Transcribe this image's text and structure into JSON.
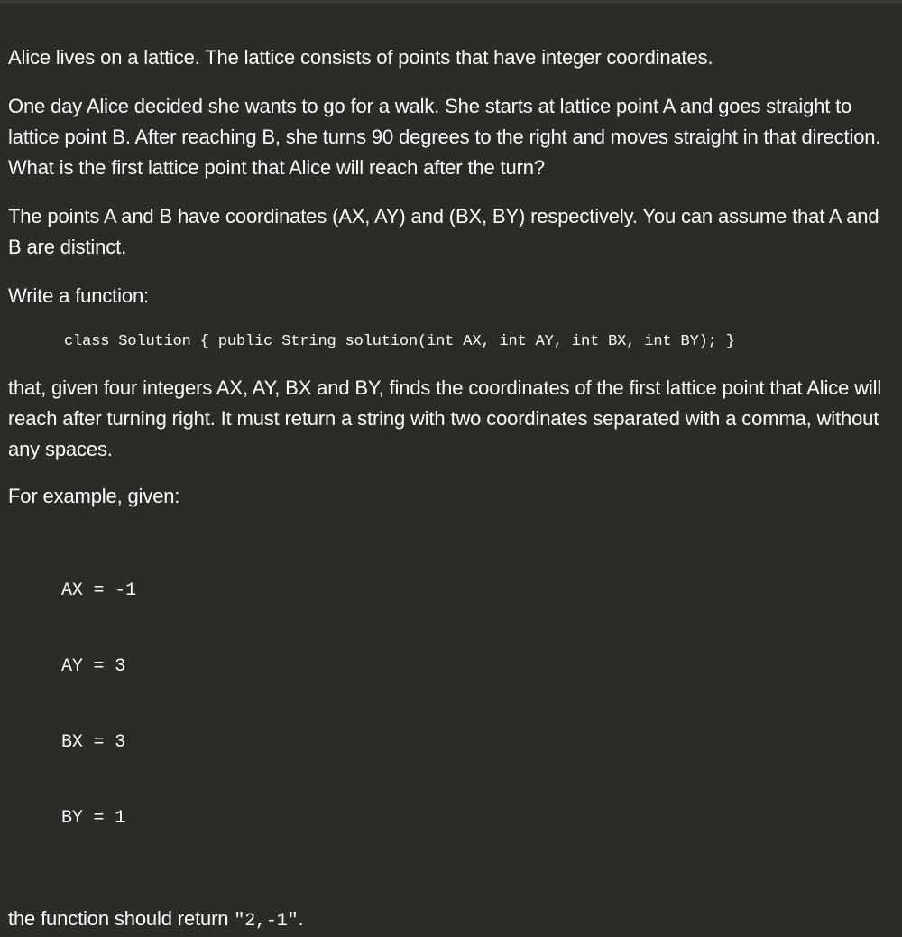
{
  "paragraphs": {
    "intro": "Alice lives on a lattice. The lattice consists of points that have integer coordinates.",
    "walk": "One day Alice decided she wants to go for a walk. She starts at lattice point A and goes straight to lattice point B. After reaching B, she turns 90 degrees to the right and moves straight in that direction. What is the first lattice point that Alice will reach after the turn?",
    "coords": "The points A and B have coordinates (AX, AY) and (BX, BY) respectively. You can assume that A and B are distinct.",
    "write_fn": "Write a function:",
    "task": "that, given four integers AX, AY, BX and BY, finds the coordinates of the first lattice point that Alice will reach after turning right. It must return a string with two coordinates separated with a comma, without any spaces.",
    "example_intro": "For example, given:",
    "return_prefix": "the function should return ",
    "return_value": "\"2,-1\"",
    "return_suffix": "."
  },
  "code_signature": "class Solution { public String solution(int AX, int AY, int BX, int BY); }",
  "example_values": [
    "AX = -1",
    "AY = 3",
    "BX = 3",
    "BY = 1"
  ],
  "colors": {
    "background": "#2b2b27",
    "text": "#ffffff"
  }
}
